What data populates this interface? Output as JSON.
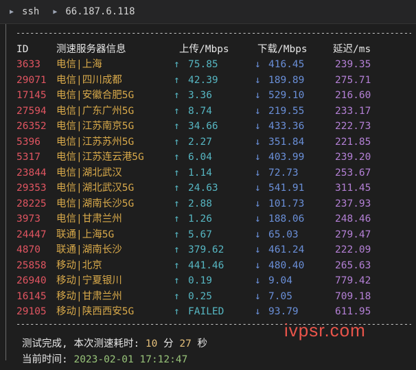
{
  "tab": {
    "label": "ssh",
    "host": "66.187.6.118"
  },
  "headers": {
    "id": "ID",
    "server": "测速服务器信息",
    "upload": "上传/Mbps",
    "download": "下载/Mbps",
    "latency": "延迟/ms"
  },
  "arrows": {
    "up": "↑",
    "down": "↓"
  },
  "rows": [
    {
      "id": "3633",
      "server": "电信|上海",
      "upload": "75.85",
      "download": "416.45",
      "latency": "239.35"
    },
    {
      "id": "29071",
      "server": "电信|四川成都",
      "upload": "42.39",
      "download": "189.89",
      "latency": "275.71"
    },
    {
      "id": "17145",
      "server": "电信|安徽合肥5G",
      "upload": "3.36",
      "download": "529.10",
      "latency": "216.60"
    },
    {
      "id": "27594",
      "server": "电信|广东广州5G",
      "upload": "8.74",
      "download": "219.55",
      "latency": "233.17"
    },
    {
      "id": "26352",
      "server": "电信|江苏南京5G",
      "upload": "34.66",
      "download": "433.36",
      "latency": "222.73"
    },
    {
      "id": "5396",
      "server": "电信|江苏苏州5G",
      "upload": "2.27",
      "download": "351.84",
      "latency": "221.85"
    },
    {
      "id": "5317",
      "server": "电信|江苏连云港5G",
      "upload": "6.04",
      "download": "403.99",
      "latency": "239.20"
    },
    {
      "id": "23844",
      "server": "电信|湖北武汉",
      "upload": "1.14",
      "download": "72.73",
      "latency": "253.67"
    },
    {
      "id": "29353",
      "server": "电信|湖北武汉5G",
      "upload": "24.63",
      "download": "541.91",
      "latency": "311.45"
    },
    {
      "id": "28225",
      "server": "电信|湖南长沙5G",
      "upload": "2.88",
      "download": "101.73",
      "latency": "237.93"
    },
    {
      "id": "3973",
      "server": "电信|甘肃兰州",
      "upload": "1.26",
      "download": "188.06",
      "latency": "248.46"
    },
    {
      "id": "24447",
      "server": "联通|上海5G",
      "upload": "5.67",
      "download": "65.03",
      "latency": "279.47"
    },
    {
      "id": "4870",
      "server": "联通|湖南长沙",
      "upload": "379.62",
      "download": "461.24",
      "latency": "222.09"
    },
    {
      "id": "25858",
      "server": "移动|北京",
      "upload": "441.46",
      "download": "480.40",
      "latency": "265.63"
    },
    {
      "id": "26940",
      "server": "移动|宁夏银川",
      "upload": "0.19",
      "download": "9.04",
      "latency": "779.42"
    },
    {
      "id": "16145",
      "server": "移动|甘肃兰州",
      "upload": "0.25",
      "download": "7.05",
      "latency": "709.18"
    },
    {
      "id": "29105",
      "server": "移动|陕西西安5G",
      "upload": "FAILED",
      "download": "93.79",
      "latency": "611.95"
    }
  ],
  "footer": {
    "done_prefix": "测试完成, 本次测速耗时: ",
    "minutes": "10",
    "min_unit": " 分 ",
    "seconds": "27",
    "sec_unit": " 秒",
    "time_label": "当前时间: ",
    "time_value": "2023-02-01 17:12:47"
  },
  "watermark": "ivpsr.com",
  "colors": {
    "id": "#e05561",
    "server": "#d8a94a",
    "upload": "#56b6c2",
    "download": "#6a8fd8",
    "latency": "#b480d6"
  }
}
